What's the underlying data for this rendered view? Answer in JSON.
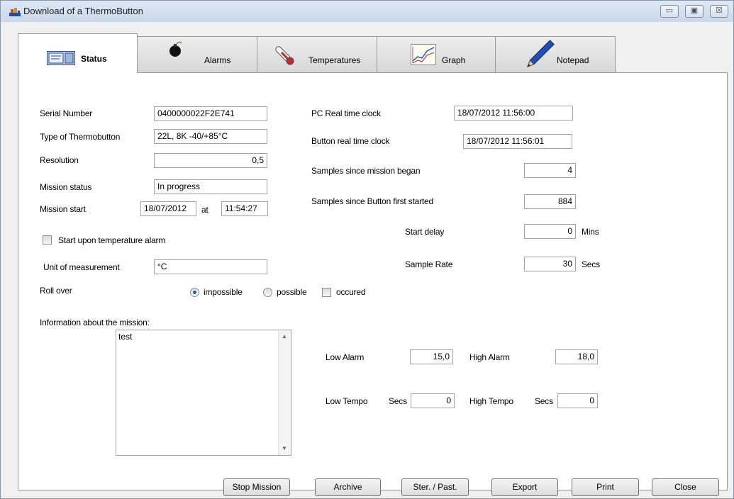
{
  "window": {
    "title": "Download of a ThermoButton",
    "controls": {
      "minimize": "▭",
      "maximize": "▣",
      "close": "☒"
    }
  },
  "tabs": [
    {
      "label": "Status",
      "icon": "status-screen-icon",
      "active": true
    },
    {
      "label": "Alarms",
      "icon": "bomb-icon",
      "active": false
    },
    {
      "label": "Temperatures",
      "icon": "thermometer-icon",
      "active": false
    },
    {
      "label": "Graph",
      "icon": "graph-icon",
      "active": false
    },
    {
      "label": "Notepad",
      "icon": "pen-icon",
      "active": false
    }
  ],
  "status": {
    "serial_number": {
      "label": "Serial Number",
      "value": "0400000022F2E741"
    },
    "type": {
      "label": "Type of Thermobutton",
      "value": "22L, 8K -40/+85°C"
    },
    "resolution": {
      "label": "Resolution",
      "value": "0,5"
    },
    "mission_status": {
      "label": "Mission status",
      "value": "In progress"
    },
    "mission_start": {
      "label": "Mission start",
      "date": "18/07/2012",
      "at": "at",
      "time": "11:54:27"
    },
    "start_upon_alarm": {
      "label": "Start upon temperature alarm",
      "checked": false
    },
    "unit": {
      "label": "Unit of measurement",
      "value": "°C"
    },
    "roll_over": {
      "label": "Roll over",
      "option_impossible": "impossible",
      "option_possible": "possible",
      "occured": "occured",
      "selected": "impossible"
    },
    "info": {
      "label": "Information about the mission:",
      "value": "test"
    },
    "pc_clock": {
      "label": "PC Real time clock",
      "value": "18/07/2012 11:56:00"
    },
    "button_clock": {
      "label": "Button real time clock",
      "value": "18/07/2012 11:56:01"
    },
    "samples_mission": {
      "label": "Samples since mission began",
      "value": "4"
    },
    "samples_started": {
      "label": "Samples since Button first started",
      "value": "884"
    },
    "start_delay": {
      "label": "Start delay",
      "value": "0",
      "unit": "Mins"
    },
    "sample_rate": {
      "label": "Sample Rate",
      "value": "30",
      "unit": "Secs"
    },
    "low_alarm": {
      "label": "Low Alarm",
      "value": "15,0"
    },
    "high_alarm": {
      "label": "High Alarm",
      "value": "18,0"
    },
    "low_tempo": {
      "label": "Low Tempo",
      "unit": "Secs",
      "value": "0"
    },
    "high_tempo": {
      "label": "High Tempo",
      "unit": "Secs",
      "value": "0"
    }
  },
  "buttons": {
    "stop_mission": "Stop Mission",
    "archive": "Archive",
    "ster_past": "Ster. / Past.",
    "export": "Export",
    "print": "Print",
    "close": "Close"
  }
}
